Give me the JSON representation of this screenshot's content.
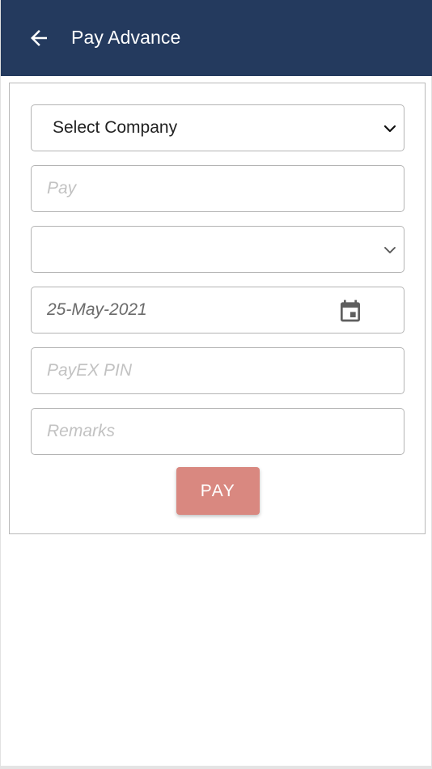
{
  "header": {
    "title": "Pay Advance",
    "back_icon": "arrow-left-icon",
    "background_color": "#243a5e"
  },
  "form": {
    "company_select": {
      "selected_label": "Select Company"
    },
    "pay_input": {
      "placeholder": "Pay",
      "value": ""
    },
    "second_select": {
      "selected_label": ""
    },
    "date_input": {
      "value": "25-May-2021",
      "icon": "calendar-icon"
    },
    "pin_input": {
      "placeholder": "PayEX PIN",
      "value": ""
    },
    "remarks_input": {
      "placeholder": "Remarks",
      "value": ""
    },
    "pay_button": {
      "label": "PAY",
      "color": "#d98880"
    }
  }
}
